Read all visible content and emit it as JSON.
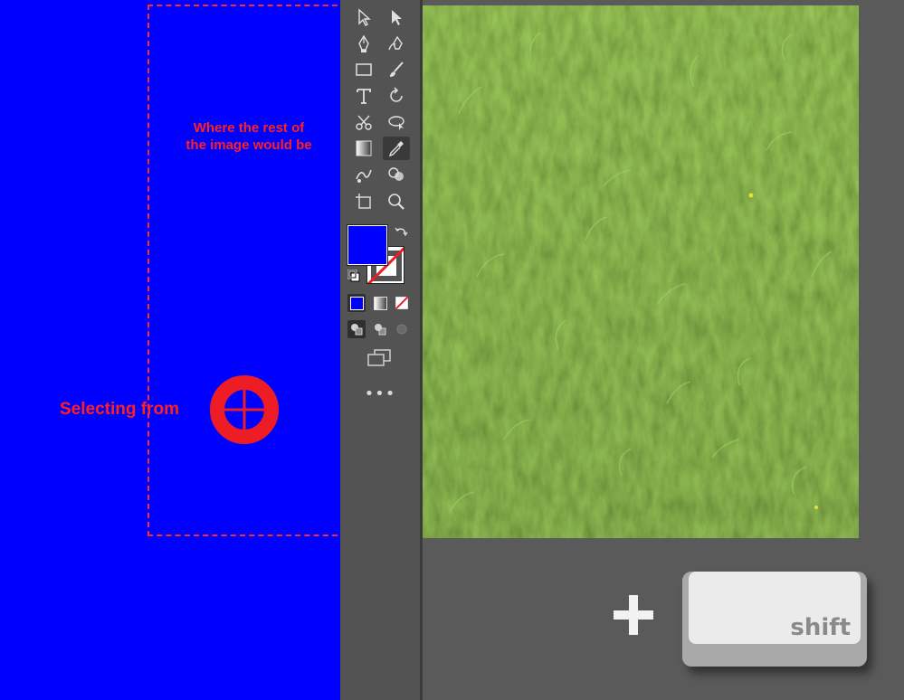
{
  "annotations": {
    "rest_of_image_line1": "Where the rest of",
    "rest_of_image_line2": "the image would be",
    "selecting_from": "Selecting from"
  },
  "toolbar": {
    "more_label": "•••",
    "tools": [
      "selection-tool",
      "direct-selection-tool",
      "pen-tool",
      "curvature-tool",
      "rectangle-tool",
      "paintbrush-tool",
      "type-tool",
      "rotate-tool",
      "scissors-tool",
      "puppet-warp-tool",
      "gradient-tool",
      "eyedropper-tool",
      "blend-tool",
      "shape-builder-tool",
      "artboard-tool",
      "zoom-tool"
    ],
    "active_tool": "eyedropper-tool",
    "fill_color": "#0000ff",
    "stroke": "none"
  },
  "keyboard": {
    "modifier_key": "shift",
    "plus": "+"
  },
  "colors": {
    "accent": "#ff2020",
    "fill": "#0000ff",
    "toolbar_bg": "#535353",
    "workspace_bg": "#5a5a5a"
  }
}
